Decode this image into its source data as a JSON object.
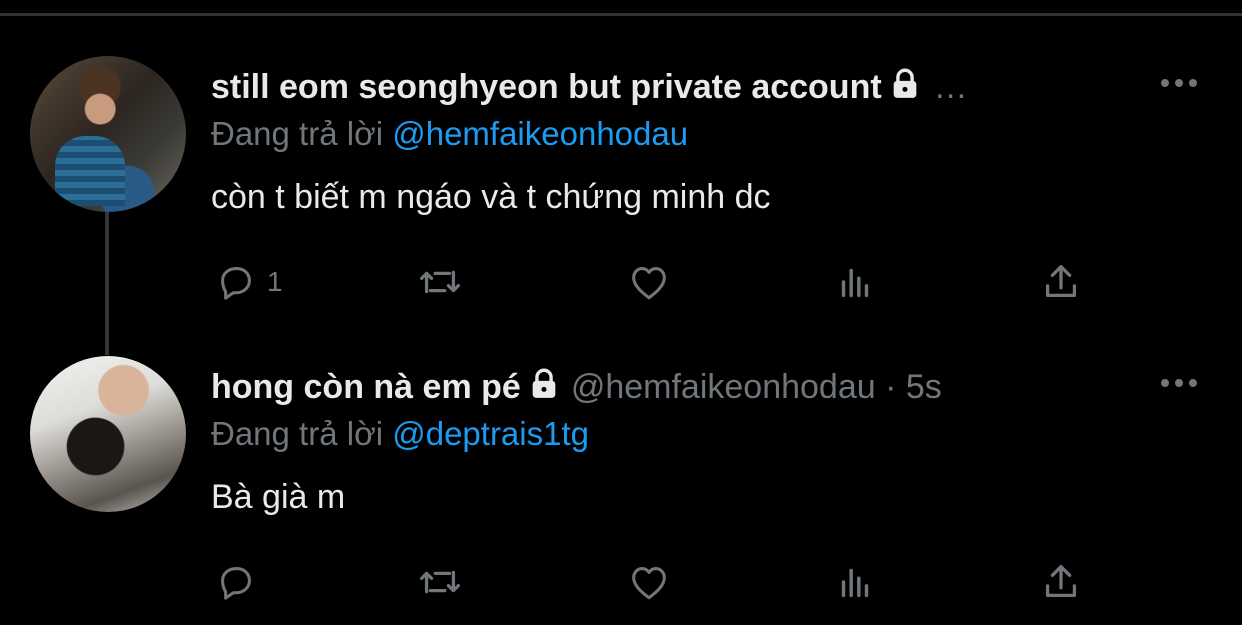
{
  "tweets": [
    {
      "display_name": "still eom seonghyeon but private account",
      "handle": "",
      "truncation": "…",
      "time": "",
      "replying_label": "Đang trả lời",
      "replying_to": "@hemfaikeonhodau",
      "text": "còn t biết m ngáo và t chứng minh dc",
      "reply_count": "1",
      "retweet_count": "",
      "like_count": "",
      "view_count": ""
    },
    {
      "display_name": "hong còn nà em pé",
      "handle": "@hemfaikeonhodau · 5s",
      "truncation": "",
      "time": "",
      "replying_label": "Đang trả lời",
      "replying_to": "@deptrais1tg",
      "text": "Bà già m",
      "reply_count": "",
      "retweet_count": "",
      "like_count": "",
      "view_count": ""
    }
  ],
  "icons": {
    "reply": "reply-icon",
    "retweet": "retweet-icon",
    "like": "heart-icon",
    "views": "views-icon",
    "share": "share-icon",
    "more": "more-icon",
    "lock": "lock-icon"
  },
  "colors": {
    "background": "#000000",
    "text": "#e7e9ea",
    "muted": "#71767b",
    "accent": "#1d9bf0",
    "divider": "#2f3336"
  }
}
